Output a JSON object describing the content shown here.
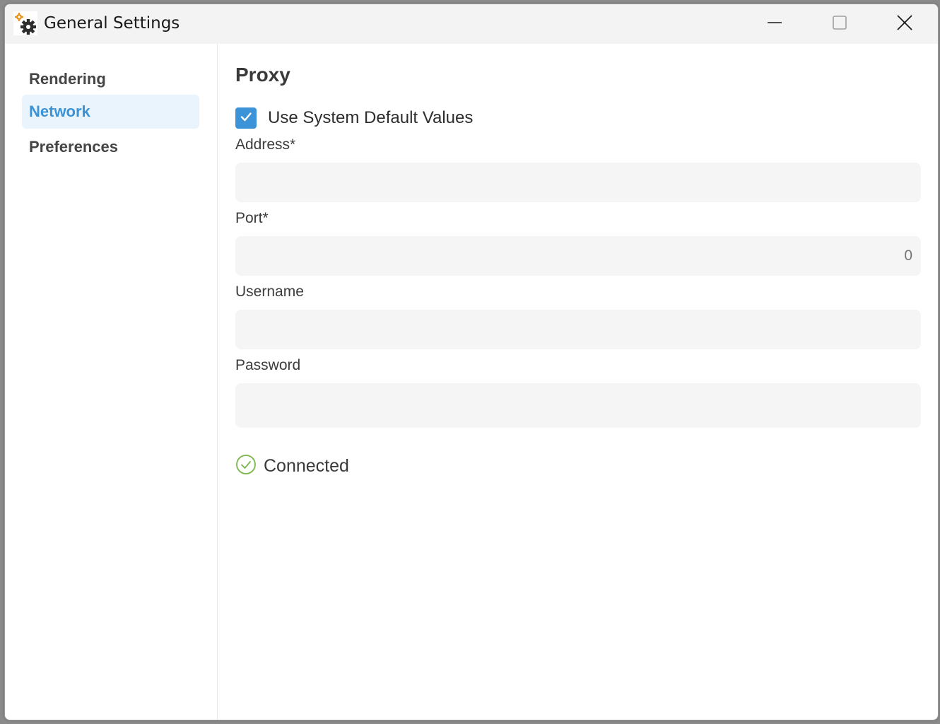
{
  "window": {
    "title": "General Settings",
    "icon": "gear-settings-icon",
    "buttons": [
      "minimize-icon",
      "maximize-icon",
      "close-icon"
    ]
  },
  "sidebar": {
    "items": [
      {
        "label": "Rendering",
        "active": false
      },
      {
        "label": "Network",
        "active": true
      },
      {
        "label": "Preferences",
        "active": false
      }
    ]
  },
  "proxy": {
    "title": "Proxy",
    "use_system_default": {
      "label": "Use System Default Values",
      "checked": true
    },
    "address": {
      "label": "Address*",
      "value": "",
      "placeholder": ""
    },
    "port": {
      "label": "Port*",
      "value": "",
      "placeholder": "0"
    },
    "username": {
      "label": "Username",
      "value": "",
      "placeholder": ""
    },
    "password": {
      "label": "Password",
      "value": "",
      "placeholder": ""
    },
    "status": {
      "text": "Connected",
      "icon": "check-circle-icon"
    }
  },
  "colors": {
    "accent": "#3d93d8",
    "active_nav_bg": "#eaf4fd",
    "status_ok": "#7ab648",
    "input_bg": "#f5f5f5"
  }
}
